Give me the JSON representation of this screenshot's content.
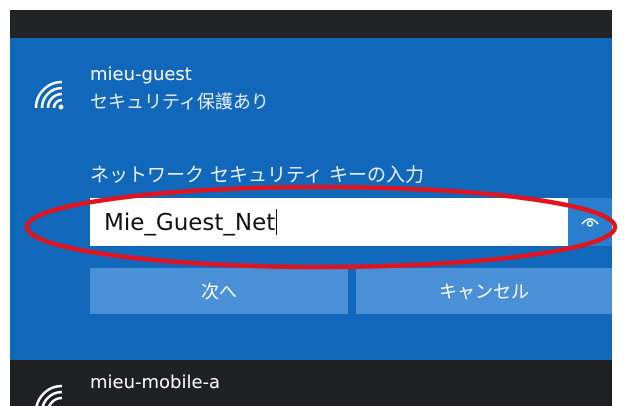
{
  "selected_network": {
    "name": "mieu-guest",
    "status": "セキュリティ保護あり",
    "prompt": "ネットワーク セキュリティ キーの入力",
    "key_value": "Mie_Guest_Net",
    "next_label": "次へ",
    "cancel_label": "キャンセル"
  },
  "other_network": {
    "name": "mieu-mobile-a"
  },
  "colors": {
    "selected_bg": "#1168bb",
    "button_bg": "#4a90d6",
    "annotation": "#e0141e"
  },
  "icons": {
    "wifi": "wifi-icon",
    "reveal": "eye-icon"
  }
}
